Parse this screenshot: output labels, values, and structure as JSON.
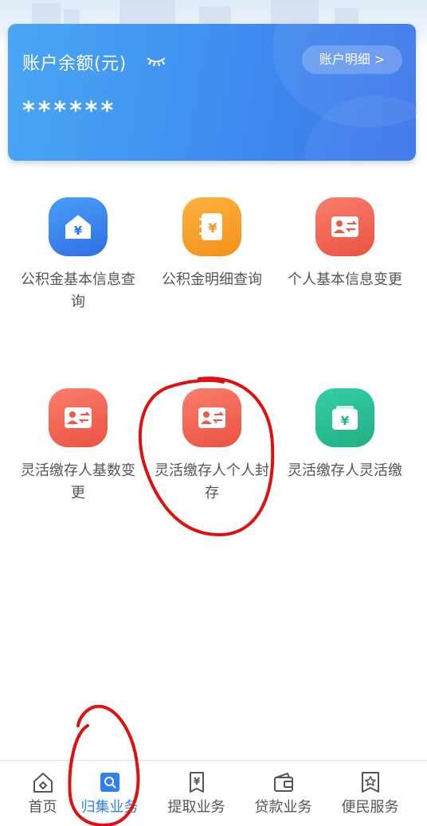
{
  "card": {
    "title": "账户余额(元)",
    "detail_label": "账户明细 >",
    "masked_balance": "******"
  },
  "services": [
    {
      "label": "公积金基本信息查询",
      "icon": "house-yuan-icon",
      "color": "#3f86f0"
    },
    {
      "label": "公积金明细查询",
      "icon": "notebook-yuan-icon",
      "color": "#f6a02a"
    },
    {
      "label": "个人基本信息变更",
      "icon": "id-card-swap-icon",
      "color": "#f06552"
    },
    {
      "label": "灵活缴存人基数变更",
      "icon": "id-card-swap-icon",
      "color": "#f06552"
    },
    {
      "label": "灵活缴存人个人封存",
      "icon": "id-card-swap-icon",
      "color": "#f06552"
    },
    {
      "label": "灵活缴存人灵活缴",
      "icon": "wallet-yuan-icon",
      "color": "#2cc096"
    }
  ],
  "tabs": [
    {
      "label": "首页",
      "icon": "home-icon",
      "active": false
    },
    {
      "label": "归集业务",
      "icon": "search-icon",
      "active": true
    },
    {
      "label": "提取业务",
      "icon": "document-yuan-icon",
      "active": false
    },
    {
      "label": "贷款业务",
      "icon": "wallet-icon",
      "active": false
    },
    {
      "label": "便民服务",
      "icon": "star-badge-icon",
      "active": false
    }
  ],
  "colors": {
    "accent": "#2f7ff0",
    "annotation": "#e01010"
  }
}
